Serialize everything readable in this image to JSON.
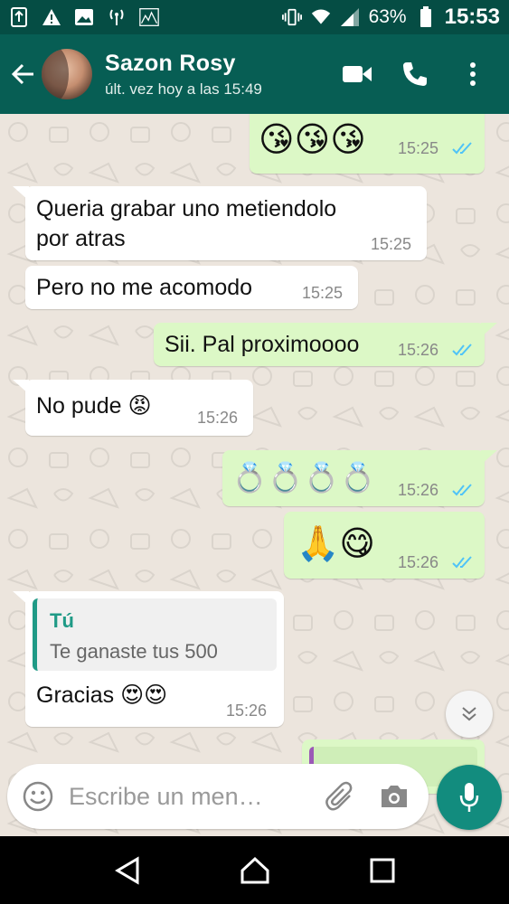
{
  "status_bar": {
    "battery": "63%",
    "time": "15:53",
    "icons": [
      "usb-debug-icon",
      "warning-icon",
      "image-icon",
      "signal-tower-icon",
      "data-icon",
      "vibrate-icon",
      "wifi-icon",
      "cell-signal-icon",
      "battery-icon"
    ]
  },
  "header": {
    "contact_name": "Sazon Rosy",
    "last_seen": "últ. vez hoy a las 15:49",
    "actions": [
      "video-call-icon",
      "phone-icon",
      "more-icon"
    ]
  },
  "messages": [
    {
      "dir": "out",
      "text": "😘😘😘",
      "time": "15:25",
      "ticks": "read"
    },
    {
      "dir": "in",
      "text_lines": [
        "Queria grabar uno metiendolo",
        "por atras"
      ],
      "time": "15:25"
    },
    {
      "dir": "in",
      "text": "Pero no me acomodo",
      "time": "15:25"
    },
    {
      "dir": "out",
      "text": "Sii. Pal proximoooo",
      "time": "15:26",
      "ticks": "read"
    },
    {
      "dir": "in",
      "text": "No pude 😡",
      "time": "15:26"
    },
    {
      "dir": "out",
      "text": "💍💍💍💍",
      "time": "15:26",
      "ticks": "read"
    },
    {
      "dir": "out",
      "text": "🙏😋",
      "time": "15:26",
      "ticks": "read"
    },
    {
      "dir": "in",
      "quote_author": "Tú",
      "quote_text": "Te ganaste tus 500",
      "text": "Gracias 😍😍",
      "time": "15:26"
    }
  ],
  "input": {
    "placeholder": "Escribe un men…"
  },
  "colors": {
    "status_bar": "#054d44",
    "app_bar": "#075e54",
    "chat_bg": "#ece5dd",
    "outgoing": "#dcf8c6",
    "incoming": "#ffffff",
    "accent": "#128c7e",
    "read_ticks": "#4fc3f7"
  }
}
